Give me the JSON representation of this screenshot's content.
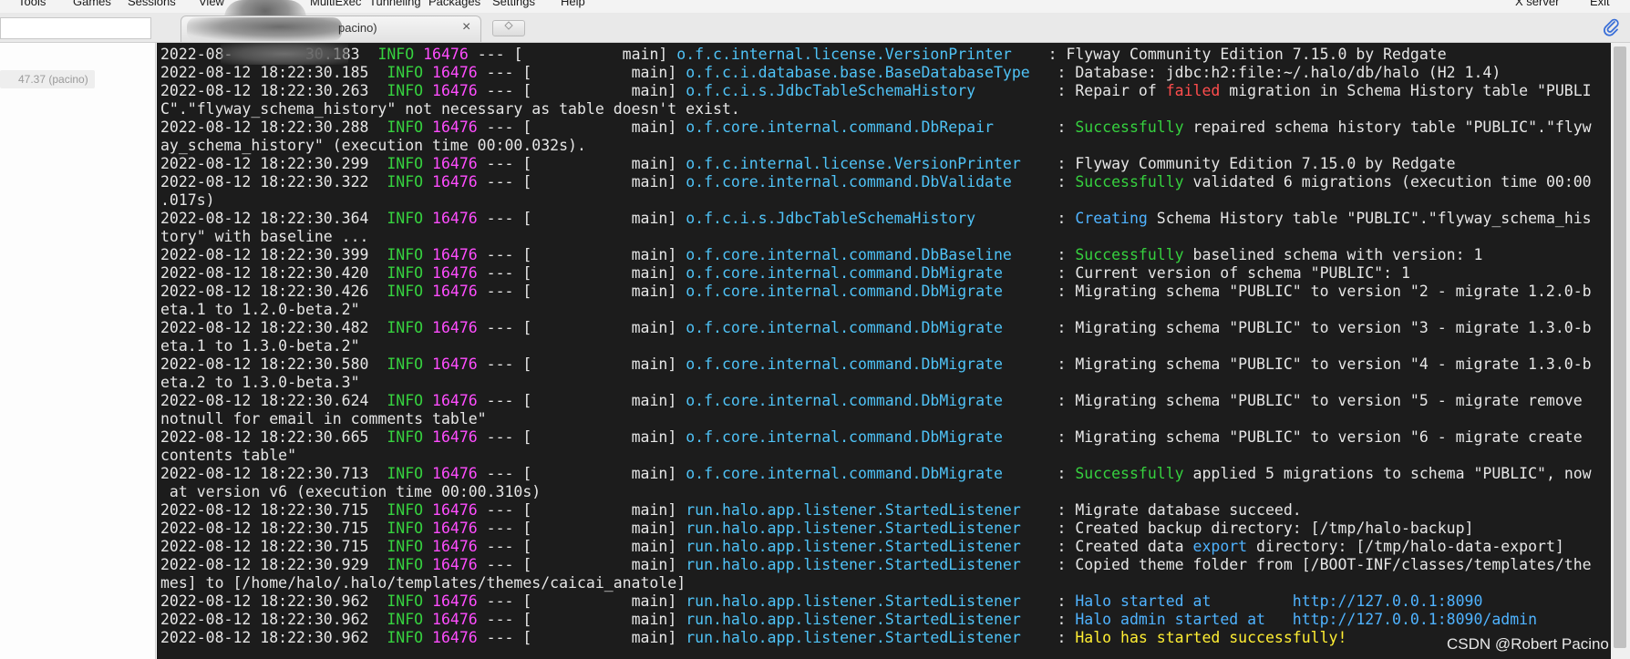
{
  "menu": {
    "items": [
      "Tools",
      "Games",
      "Sessions",
      "View",
      "MultiExec",
      "Tunneling",
      "Packages",
      "Settings",
      "Help",
      "X server",
      "Exit"
    ]
  },
  "tab": {
    "label": "pacino)",
    "close": "×"
  },
  "sidebar": {
    "session_label": "47.37 (pacino)"
  },
  "watermark": "CSDN @Robert Pacino",
  "log": [
    [
      {
        "t": "2022-08-"
      },
      {
        "t": "        30.183  "
      },
      {
        "t": "INFO",
        "c": "c-info"
      },
      {
        "t": " "
      },
      {
        "t": "16476",
        "c": "c-pid"
      },
      {
        "t": " --- [           main] "
      },
      {
        "t": "o.f.c.internal.license.VersionPrinter   ",
        "c": "c-logger"
      },
      {
        "t": " : Flyway Community Edition 7.15.0 by Redgate"
      }
    ],
    [
      {
        "t": "2022-08-12 18:22:30.185  "
      },
      {
        "t": "INFO",
        "c": "c-info"
      },
      {
        "t": " "
      },
      {
        "t": "16476",
        "c": "c-pid"
      },
      {
        "t": " --- [           main] "
      },
      {
        "t": "o.f.c.i.database.base.BaseDatabaseType  ",
        "c": "c-logger"
      },
      {
        "t": " : Database: jdbc:h2:file:~/.halo/db/halo (H2 1.4)"
      }
    ],
    [
      {
        "t": "2022-08-12 18:22:30.263  "
      },
      {
        "t": "INFO",
        "c": "c-info"
      },
      {
        "t": " "
      },
      {
        "t": "16476",
        "c": "c-pid"
      },
      {
        "t": " --- [           main] "
      },
      {
        "t": "o.f.c.i.s.JdbcTableSchemaHistory        ",
        "c": "c-logger"
      },
      {
        "t": " : Repair of "
      },
      {
        "t": "failed",
        "c": "c-red"
      },
      {
        "t": " migration in Schema History table \"PUBLI"
      }
    ],
    [
      {
        "t": "C\".\"flyway_schema_history\" not necessary as table doesn't exist."
      }
    ],
    [
      {
        "t": "2022-08-12 18:22:30.288  "
      },
      {
        "t": "INFO",
        "c": "c-info"
      },
      {
        "t": " "
      },
      {
        "t": "16476",
        "c": "c-pid"
      },
      {
        "t": " --- [           main] "
      },
      {
        "t": "o.f.core.internal.command.DbRepair      ",
        "c": "c-logger"
      },
      {
        "t": " : "
      },
      {
        "t": "Successfully",
        "c": "c-green"
      },
      {
        "t": " repaired schema history table \"PUBLIC\".\"flyw"
      }
    ],
    [
      {
        "t": "ay_schema_history\" (execution time 00:00.032s)."
      }
    ],
    [
      {
        "t": "2022-08-12 18:22:30.299  "
      },
      {
        "t": "INFO",
        "c": "c-info"
      },
      {
        "t": " "
      },
      {
        "t": "16476",
        "c": "c-pid"
      },
      {
        "t": " --- [           main] "
      },
      {
        "t": "o.f.c.internal.license.VersionPrinter   ",
        "c": "c-logger"
      },
      {
        "t": " : Flyway Community Edition 7.15.0 by Redgate"
      }
    ],
    [
      {
        "t": "2022-08-12 18:22:30.322  "
      },
      {
        "t": "INFO",
        "c": "c-info"
      },
      {
        "t": " "
      },
      {
        "t": "16476",
        "c": "c-pid"
      },
      {
        "t": " --- [           main] "
      },
      {
        "t": "o.f.core.internal.command.DbValidate    ",
        "c": "c-logger"
      },
      {
        "t": " : "
      },
      {
        "t": "Successfully",
        "c": "c-green"
      },
      {
        "t": " validated 6 migrations (execution time 00:00"
      }
    ],
    [
      {
        "t": ".017s)"
      }
    ],
    [
      {
        "t": "2022-08-12 18:22:30.364  "
      },
      {
        "t": "INFO",
        "c": "c-info"
      },
      {
        "t": " "
      },
      {
        "t": "16476",
        "c": "c-pid"
      },
      {
        "t": " --- [           main] "
      },
      {
        "t": "o.f.c.i.s.JdbcTableSchemaHistory        ",
        "c": "c-logger"
      },
      {
        "t": " : "
      },
      {
        "t": "Creating",
        "c": "c-blue"
      },
      {
        "t": " Schema History table \"PUBLIC\".\"flyway_schema_his"
      }
    ],
    [
      {
        "t": "tory\" with baseline ..."
      }
    ],
    [
      {
        "t": "2022-08-12 18:22:30.399  "
      },
      {
        "t": "INFO",
        "c": "c-info"
      },
      {
        "t": " "
      },
      {
        "t": "16476",
        "c": "c-pid"
      },
      {
        "t": " --- [           main] "
      },
      {
        "t": "o.f.core.internal.command.DbBaseline    ",
        "c": "c-logger"
      },
      {
        "t": " : "
      },
      {
        "t": "Successfully",
        "c": "c-green"
      },
      {
        "t": " baselined schema with version: 1"
      }
    ],
    [
      {
        "t": "2022-08-12 18:22:30.420  "
      },
      {
        "t": "INFO",
        "c": "c-info"
      },
      {
        "t": " "
      },
      {
        "t": "16476",
        "c": "c-pid"
      },
      {
        "t": " --- [           main] "
      },
      {
        "t": "o.f.core.internal.command.DbMigrate     ",
        "c": "c-logger"
      },
      {
        "t": " : Current version of schema \"PUBLIC\": 1"
      }
    ],
    [
      {
        "t": "2022-08-12 18:22:30.426  "
      },
      {
        "t": "INFO",
        "c": "c-info"
      },
      {
        "t": " "
      },
      {
        "t": "16476",
        "c": "c-pid"
      },
      {
        "t": " --- [           main] "
      },
      {
        "t": "o.f.core.internal.command.DbMigrate     ",
        "c": "c-logger"
      },
      {
        "t": " : Migrating schema \"PUBLIC\" to version \"2 - migrate 1.2.0-b"
      }
    ],
    [
      {
        "t": "eta.1 to 1.2.0-beta.2\""
      }
    ],
    [
      {
        "t": "2022-08-12 18:22:30.482  "
      },
      {
        "t": "INFO",
        "c": "c-info"
      },
      {
        "t": " "
      },
      {
        "t": "16476",
        "c": "c-pid"
      },
      {
        "t": " --- [           main] "
      },
      {
        "t": "o.f.core.internal.command.DbMigrate     ",
        "c": "c-logger"
      },
      {
        "t": " : Migrating schema \"PUBLIC\" to version \"3 - migrate 1.3.0-b"
      }
    ],
    [
      {
        "t": "eta.1 to 1.3.0-beta.2\""
      }
    ],
    [
      {
        "t": "2022-08-12 18:22:30.580  "
      },
      {
        "t": "INFO",
        "c": "c-info"
      },
      {
        "t": " "
      },
      {
        "t": "16476",
        "c": "c-pid"
      },
      {
        "t": " --- [           main] "
      },
      {
        "t": "o.f.core.internal.command.DbMigrate     ",
        "c": "c-logger"
      },
      {
        "t": " : Migrating schema \"PUBLIC\" to version \"4 - migrate 1.3.0-b"
      }
    ],
    [
      {
        "t": "eta.2 to 1.3.0-beta.3\""
      }
    ],
    [
      {
        "t": "2022-08-12 18:22:30.624  "
      },
      {
        "t": "INFO",
        "c": "c-info"
      },
      {
        "t": " "
      },
      {
        "t": "16476",
        "c": "c-pid"
      },
      {
        "t": " --- [           main] "
      },
      {
        "t": "o.f.core.internal.command.DbMigrate     ",
        "c": "c-logger"
      },
      {
        "t": " : Migrating schema \"PUBLIC\" to version \"5 - migrate remove"
      }
    ],
    [
      {
        "t": "notnull for email in comments table\""
      }
    ],
    [
      {
        "t": "2022-08-12 18:22:30.665  "
      },
      {
        "t": "INFO",
        "c": "c-info"
      },
      {
        "t": " "
      },
      {
        "t": "16476",
        "c": "c-pid"
      },
      {
        "t": " --- [           main] "
      },
      {
        "t": "o.f.core.internal.command.DbMigrate     ",
        "c": "c-logger"
      },
      {
        "t": " : Migrating schema \"PUBLIC\" to version \"6 - migrate create"
      }
    ],
    [
      {
        "t": "contents table\""
      }
    ],
    [
      {
        "t": "2022-08-12 18:22:30.713  "
      },
      {
        "t": "INFO",
        "c": "c-info"
      },
      {
        "t": " "
      },
      {
        "t": "16476",
        "c": "c-pid"
      },
      {
        "t": " --- [           main] "
      },
      {
        "t": "o.f.core.internal.command.DbMigrate     ",
        "c": "c-logger"
      },
      {
        "t": " : "
      },
      {
        "t": "Successfully",
        "c": "c-green"
      },
      {
        "t": " applied 5 migrations to schema \"PUBLIC\", now"
      }
    ],
    [
      {
        "t": " at version v6 (execution time 00:00.310s)"
      }
    ],
    [
      {
        "t": "2022-08-12 18:22:30.715  "
      },
      {
        "t": "INFO",
        "c": "c-info"
      },
      {
        "t": " "
      },
      {
        "t": "16476",
        "c": "c-pid"
      },
      {
        "t": " --- [           main] "
      },
      {
        "t": "run.halo.app.listener.StartedListener   ",
        "c": "c-logger"
      },
      {
        "t": " : Migrate database succeed."
      }
    ],
    [
      {
        "t": "2022-08-12 18:22:30.715  "
      },
      {
        "t": "INFO",
        "c": "c-info"
      },
      {
        "t": " "
      },
      {
        "t": "16476",
        "c": "c-pid"
      },
      {
        "t": " --- [           main] "
      },
      {
        "t": "run.halo.app.listener.StartedListener   ",
        "c": "c-logger"
      },
      {
        "t": " : Created backup directory: [/tmp/halo-backup]"
      }
    ],
    [
      {
        "t": "2022-08-12 18:22:30.715  "
      },
      {
        "t": "INFO",
        "c": "c-info"
      },
      {
        "t": " "
      },
      {
        "t": "16476",
        "c": "c-pid"
      },
      {
        "t": " --- [           main] "
      },
      {
        "t": "run.halo.app.listener.StartedListener   ",
        "c": "c-logger"
      },
      {
        "t": " : Created data "
      },
      {
        "t": "export",
        "c": "c-blue"
      },
      {
        "t": " directory: [/tmp/halo-data-export]"
      }
    ],
    [
      {
        "t": "2022-08-12 18:22:30.929  "
      },
      {
        "t": "INFO",
        "c": "c-info"
      },
      {
        "t": " "
      },
      {
        "t": "16476",
        "c": "c-pid"
      },
      {
        "t": " --- [           main] "
      },
      {
        "t": "run.halo.app.listener.StartedListener   ",
        "c": "c-logger"
      },
      {
        "t": " : Copied theme folder from [/BOOT-INF/classes/templates/the"
      }
    ],
    [
      {
        "t": "mes] to [/home/halo/.halo/templates/themes/caicai_anatole]"
      }
    ],
    [
      {
        "t": "2022-08-12 18:22:30.962  "
      },
      {
        "t": "INFO",
        "c": "c-info"
      },
      {
        "t": " "
      },
      {
        "t": "16476",
        "c": "c-pid"
      },
      {
        "t": " --- [           main] "
      },
      {
        "t": "run.halo.app.listener.StartedListener   ",
        "c": "c-logger"
      },
      {
        "t": " : "
      },
      {
        "t": "Halo started at         http://127.0.0.1:8090",
        "c": "c-blue"
      }
    ],
    [
      {
        "t": "2022-08-12 18:22:30.962  "
      },
      {
        "t": "INFO",
        "c": "c-info"
      },
      {
        "t": " "
      },
      {
        "t": "16476",
        "c": "c-pid"
      },
      {
        "t": " --- [           main] "
      },
      {
        "t": "run.halo.app.listener.StartedListener   ",
        "c": "c-logger"
      },
      {
        "t": " : "
      },
      {
        "t": "Halo admin started at   http://127.0.0.1:8090/admin",
        "c": "c-blue"
      }
    ],
    [
      {
        "t": "2022-08-12 18:22:30.962  "
      },
      {
        "t": "INFO",
        "c": "c-info"
      },
      {
        "t": " "
      },
      {
        "t": "16476",
        "c": "c-pid"
      },
      {
        "t": " --- [           main] "
      },
      {
        "t": "run.halo.app.listener.StartedListener   ",
        "c": "c-logger"
      },
      {
        "t": " : "
      },
      {
        "t": "Halo has started successfully!",
        "c": "c-yellow"
      }
    ]
  ]
}
